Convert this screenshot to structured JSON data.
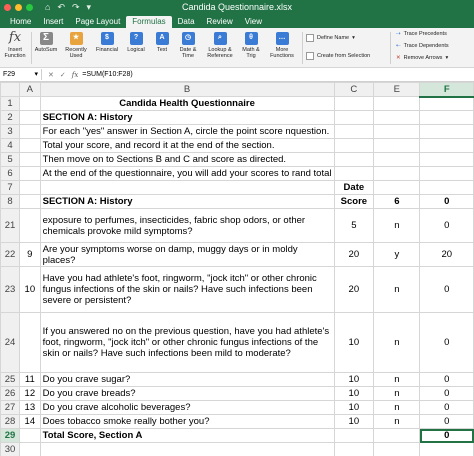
{
  "window": {
    "title": "Candida Questionnaire.xlsx"
  },
  "quick_access": [
    "⌂",
    "↶",
    "↷",
    "▾"
  ],
  "tabs": [
    "Home",
    "Insert",
    "Page Layout",
    "Formulas",
    "Data",
    "Review",
    "View"
  ],
  "ribbon": {
    "insert_function": [
      "Insert",
      "Function"
    ],
    "autosum": "AutoSum",
    "recently_used": [
      "Recently",
      "Used"
    ],
    "financial": "Financial",
    "logical": "Logical",
    "text": "Text",
    "date_time": [
      "Date &",
      "Time"
    ],
    "lookup": [
      "Lookup &",
      "Reference"
    ],
    "math_trig": [
      "Math &",
      "Trig"
    ],
    "more_functions": [
      "More",
      "Functions"
    ],
    "define_name": "Define Name",
    "create_from_selection": "Create from Selection",
    "trace_precedents": "Trace Precedents",
    "trace_dependents": "Trace Dependents",
    "remove_arrows": "Remove Arrows"
  },
  "formula_bar": {
    "name_box": "F29",
    "formula": "=SUM(F10:F28)",
    "fx": "fx"
  },
  "columns": [
    "A",
    "B",
    "C",
    "E",
    "F"
  ],
  "rows": [
    {
      "num": "1",
      "a": "",
      "b": "Candida Health Questionnaire",
      "c": "",
      "e": "",
      "f": ""
    },
    {
      "num": "2",
      "a": "",
      "b": "SECTION A:  History",
      "c": "",
      "e": "",
      "f": ""
    },
    {
      "num": "3",
      "a": "",
      "b": "For each \"yes\" answer in Section A, circle the point score nquestion.",
      "c": "",
      "e": "",
      "f": ""
    },
    {
      "num": "4",
      "a": "",
      "b": "Total your score, and record it at the end of the section.",
      "c": "",
      "e": "",
      "f": ""
    },
    {
      "num": "5",
      "a": "",
      "b": "Then move on to Sections B and C and score as directed.",
      "c": "",
      "e": "",
      "f": ""
    },
    {
      "num": "6",
      "a": "",
      "b": "At the end of the questionnaire, you will add your scores to rand total",
      "c": "",
      "e": "",
      "f": ""
    },
    {
      "num": "7",
      "a": "",
      "b": "",
      "c": "Date",
      "e": "",
      "f": ""
    },
    {
      "num": "8",
      "a": "",
      "b": "SECTION A:  History",
      "c": "Score",
      "e": "6",
      "f": "0"
    },
    {
      "num": "21",
      "a": "",
      "b": "exposure to perfumes, insecticides, fabric shop odors, or other chemicals provoke mild symptoms?",
      "c": "5",
      "e": "n",
      "f": "0"
    },
    {
      "num": "22",
      "a": "9",
      "b": "Are your symptoms worse on damp, muggy days or in moldy places?",
      "c": "20",
      "e": "y",
      "f": "20"
    },
    {
      "num": "23",
      "a": "10",
      "b": "Have you had athlete's foot, ringworm, \"jock itch\" or other chronic fungus infections of the skin or nails? Have such infections been severe or persistent?",
      "c": "20",
      "e": "n",
      "f": "0"
    },
    {
      "num": "24",
      "a": "",
      "b": "If you answered no on the previous question, have you had athlete's foot, ringworm, \"jock itch\" or other chronic fungus infections of the skin or nails? Have such infections been mild to moderate?",
      "c": "10",
      "e": "n",
      "f": "0"
    },
    {
      "num": "25",
      "a": "11",
      "b": "Do you crave sugar?",
      "c": "10",
      "e": "n",
      "f": "0"
    },
    {
      "num": "26",
      "a": "12",
      "b": "Do you crave breads?",
      "c": "10",
      "e": "n",
      "f": "0"
    },
    {
      "num": "27",
      "a": "13",
      "b": "Do you crave alcoholic beverages?",
      "c": "10",
      "e": "n",
      "f": "0"
    },
    {
      "num": "28",
      "a": "14",
      "b": "Does tobacco smoke really bother you?",
      "c": "10",
      "e": "n",
      "f": "0"
    },
    {
      "num": "29",
      "a": "",
      "b": "Total Score, Section A",
      "c": "",
      "e": "",
      "f": "0"
    },
    {
      "num": "30",
      "a": "",
      "b": "",
      "c": "",
      "e": "",
      "f": ""
    }
  ]
}
